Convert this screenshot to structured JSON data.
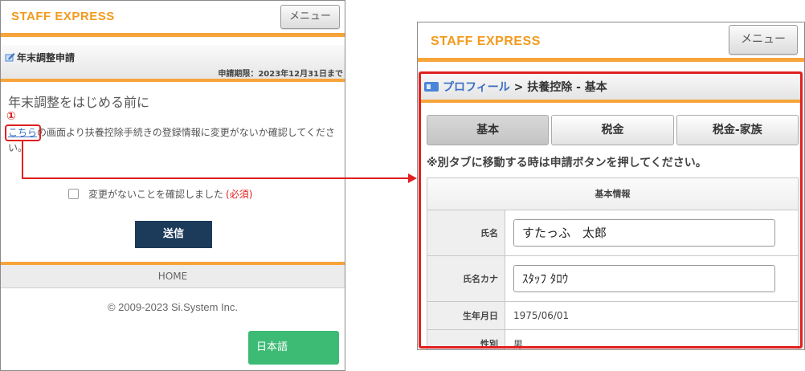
{
  "left": {
    "brand": "STAFF EXPRESS",
    "menu_label": "メニュー",
    "section_title": "年末調整申請",
    "deadline": "申請期限：2023年12月31日まで",
    "heading": "年末調整をはじめる前に",
    "marker": "①",
    "link_text": "こちら",
    "para_rest": "の画面より扶養控除手続きの登録情報に変更がないか確認してください。",
    "checkbox_label": "変更がないことを確認しました",
    "required_label": "(必須)",
    "send_label": "送信",
    "home_label": "HOME",
    "copyright": "© 2009-2023 Si.System Inc.",
    "lang_label": "日本語"
  },
  "right": {
    "brand": "STAFF EXPRESS",
    "menu_label": "メニュー",
    "breadcrumb": {
      "link": "プロフィール",
      "rest": " > 扶養控除 - 基本"
    },
    "tabs": [
      "基本",
      "税金",
      "税金-家族"
    ],
    "active_tab": "基本",
    "notice": "※別タブに移動する時は申請ボタンを押してください。",
    "info_header": "基本情報",
    "fields": {
      "name_label": "氏名",
      "name_value": "すたっふ　太郎",
      "kana_label": "氏名カナ",
      "kana_value": "ｽﾀｯﾌ ﾀﾛｳ",
      "birth_label": "生年月日",
      "birth_value": "1975/06/01",
      "gender_label": "性別",
      "gender_value": "男"
    }
  },
  "colors": {
    "brand_orange": "#f39a1e",
    "bar_orange": "#f7a43a",
    "highlight_red": "#e02020",
    "send_navy": "#1c3a5a",
    "lang_green": "#3dbb75",
    "link_blue": "#3a6fc4"
  }
}
